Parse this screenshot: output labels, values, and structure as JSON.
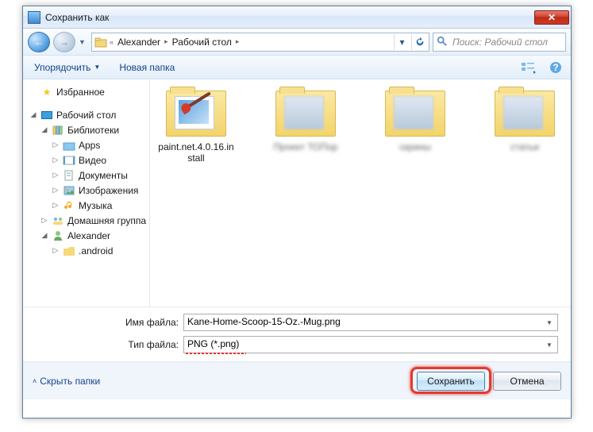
{
  "window": {
    "title": "Сохранить как"
  },
  "nav": {
    "path": [
      "Alexander",
      "Рабочий стол"
    ],
    "search_placeholder": "Поиск: Рабочий стол"
  },
  "toolbar": {
    "organize": "Упорядочить",
    "new_folder": "Новая папка"
  },
  "sidebar": {
    "favorites": "Избранное",
    "desktop": "Рабочий стол",
    "libraries": "Библиотеки",
    "apps": "Apps",
    "video": "Видео",
    "documents": "Документы",
    "pictures": "Изображения",
    "music": "Музыка",
    "homegroup": "Домашняя группа",
    "user": "Alexander",
    "android": ".android"
  },
  "content": {
    "items": [
      {
        "label": "paint.net.4.0.16.install",
        "blurred": false,
        "kind": "pnet"
      },
      {
        "label": "Проект ТОПор",
        "blurred": true,
        "kind": "blur"
      },
      {
        "label": "скрины",
        "blurred": true,
        "kind": "blur"
      },
      {
        "label": "статьи",
        "blurred": true,
        "kind": "blur"
      }
    ]
  },
  "fields": {
    "filename_label": "Имя файла:",
    "filename_value": "Kane-Home-Scoop-15-Oz.-Mug.png",
    "filetype_label": "Тип файла:",
    "filetype_value": "PNG (*.png)"
  },
  "footer": {
    "hide_folders": "Скрыть папки",
    "save": "Сохранить",
    "cancel": "Отмена"
  }
}
